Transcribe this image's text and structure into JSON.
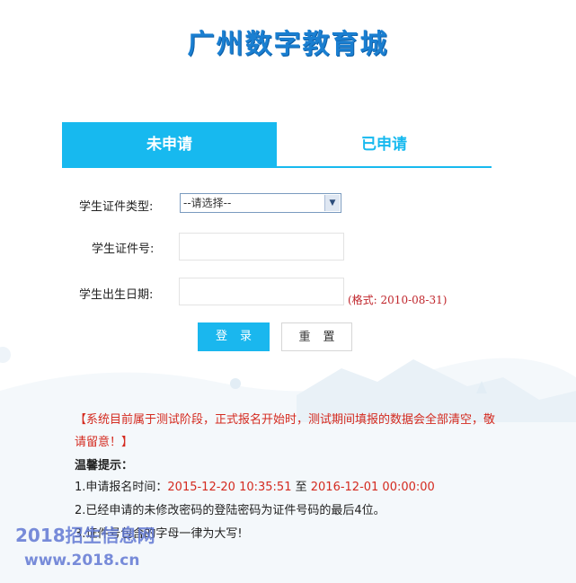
{
  "header": {
    "title": "广州数字教育城"
  },
  "tabs": [
    {
      "label": "未申请",
      "active": true
    },
    {
      "label": "已申请",
      "active": false
    }
  ],
  "form": {
    "id_type_label": "学生证件类型:",
    "id_type_value": "--请选择--",
    "id_number_label": "学生证件号:",
    "id_number_value": "",
    "birth_label": "学生出生日期:",
    "birth_value": "",
    "birth_hint": "(格式: 2010-08-31)",
    "login_label": "登录",
    "reset_label": "重置"
  },
  "notice": {
    "text": "【系统目前属于测试阶段，正式报名开始时，测试期间填报的数据会全部清空，敬请留意！】",
    "tips_title": "温馨提示：",
    "tip1_prefix": "1.申请报名时间：",
    "tip1_start": "2015-12-20 10:35:51",
    "tip1_mid": " 至 ",
    "tip1_end": "2016-12-01 00:00:00",
    "tip2": "2.已经申请的未修改密码的登陆密码为证件号码的最后4位。",
    "tip3": "3.证件号包含的字母一律为大写!"
  },
  "watermark": {
    "line1": "2018招生信息网",
    "line2": "www.2018.cn"
  },
  "colors": {
    "accent": "#17b9ef",
    "brand": "#1a7fd1",
    "alert": "#d42a1f"
  }
}
